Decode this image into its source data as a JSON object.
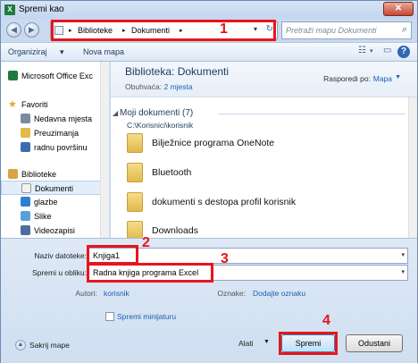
{
  "window": {
    "title": "Spremi kao",
    "close": "✕"
  },
  "address": {
    "segments": [
      "Biblioteke",
      "Dokumenti"
    ],
    "search_placeholder": "Pretraži mapu Dokumenti"
  },
  "toolbar": {
    "organize": "Organiziraj",
    "organize_dd": "▾",
    "new_folder": "Nova mapa",
    "help": "?"
  },
  "nav": {
    "items": [
      {
        "label": "Microsoft Office Exc",
        "icon": "excel-icon",
        "indent": 0
      },
      {
        "label": "Favoriti",
        "icon": "star-icon",
        "indent": 0
      },
      {
        "label": "Nedavna mjesta",
        "icon": "recent-icon",
        "indent": 1
      },
      {
        "label": "Preuzimanja",
        "icon": "download-folder-icon",
        "indent": 1
      },
      {
        "label": "radnu površinu",
        "icon": "desktop-icon",
        "indent": 1
      },
      {
        "label": "Biblioteke",
        "icon": "library-icon",
        "indent": 0
      },
      {
        "label": "Dokumenti",
        "icon": "documents-icon",
        "indent": 1,
        "selected": true
      },
      {
        "label": "glazbe",
        "icon": "music-icon",
        "indent": 1
      },
      {
        "label": "Slike",
        "icon": "pictures-icon",
        "indent": 1
      },
      {
        "label": "Videozapisi",
        "icon": "video-icon",
        "indent": 1
      }
    ]
  },
  "library": {
    "title": "Biblioteka: Dokumenti",
    "includes_label": "Obuhvaća:",
    "includes_link": "2 mjesta",
    "arrange_label": "Rasporedi po:",
    "arrange_value": "Mapa",
    "group_title": "Moji dokumenti (7)",
    "group_path": "C:\\Korisnici\\korisnik",
    "files": [
      "Bilježnice programa OneNote",
      "Bluetooth",
      "dokumenti s destopa profil korisnik",
      "Downloads"
    ]
  },
  "form": {
    "filename_label": "Naziv datoteke:",
    "filename_value": "Knjiga1",
    "type_label": "Spremi u obliku:",
    "type_value": "Radna knjiga programa Excel",
    "authors_label": "Autori:",
    "authors_value": "korisnik",
    "tags_label": "Oznake:",
    "tags_value": "Dodajte oznaku",
    "thumbnail_label": "Spremi minijaturu",
    "hide_folders": "Sakrij mape",
    "tools": "Alati",
    "save": "Spremi",
    "cancel": "Odustani"
  },
  "annotations": [
    "1",
    "2",
    "3",
    "4"
  ],
  "colors": {
    "highlight": "#e8141c",
    "link": "#1a5fb4"
  }
}
